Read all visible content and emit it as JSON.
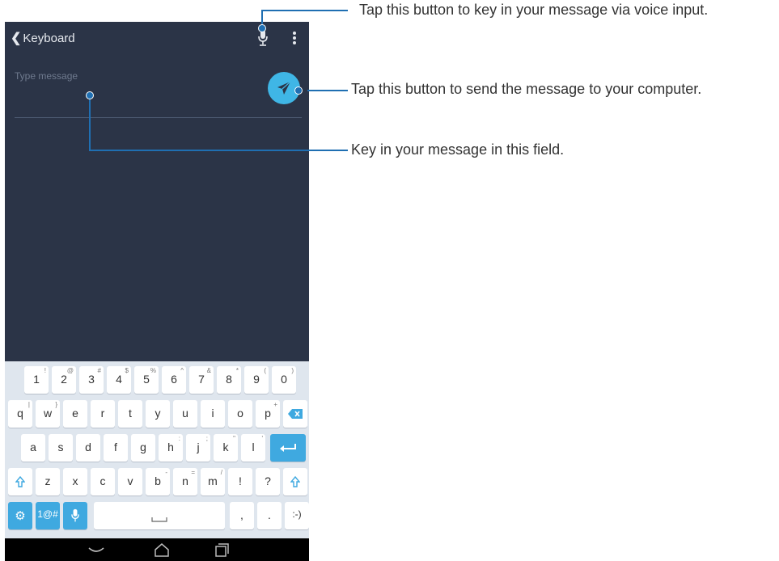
{
  "appbar": {
    "back_label": "Keyboard"
  },
  "message": {
    "placeholder": "Type message"
  },
  "keyboard": {
    "row1": [
      {
        "k": "1",
        "s": "!"
      },
      {
        "k": "2",
        "s": "@"
      },
      {
        "k": "3",
        "s": "#"
      },
      {
        "k": "4",
        "s": "$"
      },
      {
        "k": "5",
        "s": "%"
      },
      {
        "k": "6",
        "s": "^"
      },
      {
        "k": "7",
        "s": "&"
      },
      {
        "k": "8",
        "s": "*"
      },
      {
        "k": "9",
        "s": "("
      },
      {
        "k": "0",
        "s": ")"
      }
    ],
    "row2": [
      {
        "k": "q",
        "s": "|"
      },
      {
        "k": "w",
        "s": "}"
      },
      {
        "k": "e",
        "s": ""
      },
      {
        "k": "r",
        "s": ""
      },
      {
        "k": "t",
        "s": ""
      },
      {
        "k": "y",
        "s": ""
      },
      {
        "k": "u",
        "s": ""
      },
      {
        "k": "i",
        "s": ""
      },
      {
        "k": "o",
        "s": ""
      },
      {
        "k": "p",
        "s": "+"
      }
    ],
    "row3": [
      {
        "k": "a",
        "s": ""
      },
      {
        "k": "s",
        "s": ""
      },
      {
        "k": "d",
        "s": ""
      },
      {
        "k": "f",
        "s": ""
      },
      {
        "k": "g",
        "s": ""
      },
      {
        "k": "h",
        "s": ":"
      },
      {
        "k": "j",
        "s": ";"
      },
      {
        "k": "k",
        "s": "\""
      },
      {
        "k": "l",
        "s": "'"
      }
    ],
    "row4": [
      {
        "k": "z",
        "s": ""
      },
      {
        "k": "x",
        "s": ""
      },
      {
        "k": "c",
        "s": ""
      },
      {
        "k": "v",
        "s": ""
      },
      {
        "k": "b",
        "s": "-"
      },
      {
        "k": "n",
        "s": "="
      },
      {
        "k": "m",
        "s": "/"
      },
      {
        "k": "!",
        "s": ""
      },
      {
        "k": "?",
        "s": ""
      }
    ],
    "symbols_label": "1@#",
    "comma_label": ",",
    "period_label": ".",
    "emoji_label": ":-)"
  },
  "callouts": {
    "voice": "Tap this button to key in your message via voice input.",
    "send": "Tap this button to send the message to your computer.",
    "field": "Key in your message in this field."
  },
  "colors": {
    "screen_bg": "#2b3447",
    "accent": "#3fb6e6",
    "keyboard_bg": "#dfe6ee",
    "callout_line": "#1f6fb2"
  }
}
